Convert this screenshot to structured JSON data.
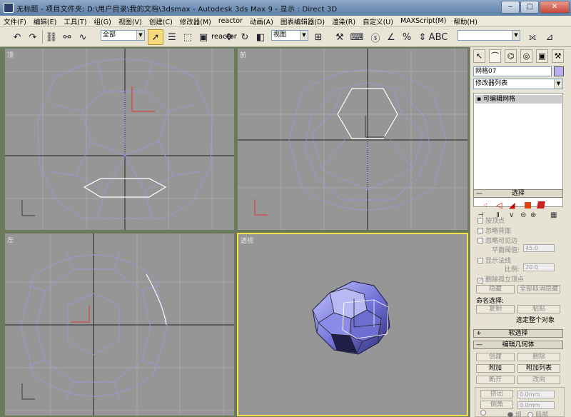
{
  "titlebar": {
    "title": "无标题  - 项目文件夹: D:\\用户目录\\我的文档\\3dsmax   - Autodesk 3ds Max 9   - 显示 : Direct 3D",
    "minimize": "‒",
    "maximize": "□",
    "close": "✕"
  },
  "menu": [
    "文件(F)",
    "编辑(E)",
    "工具(T)",
    "组(G)",
    "视图(V)",
    "创建(C)",
    "修改器(M)",
    "reactor",
    "动画(A)",
    "图表编辑器(D)",
    "渲染(R)",
    "自定义(U)",
    "MAXScript(M)",
    "帮助(H)"
  ],
  "toolbar": {
    "selection_filter": "全部",
    "reference_coord": "视图",
    "named_selection": ""
  },
  "viewports": {
    "top": "顶",
    "front": "前",
    "left": "左",
    "perspective": "透视"
  },
  "panel": {
    "object_name": "网格07",
    "object_color": "#b8aef0",
    "modifier_list": "修改器列表",
    "stack_item": "可编辑网格",
    "selection": {
      "title": "选择",
      "by_vertex": "按顶点",
      "ignore_backfacing": "忽略背面",
      "ignore_visible_edges": "忽略可见边",
      "planar_threshold_label": "平面阈值:",
      "planar_threshold_value": "45.0",
      "show_normals": "显示法线",
      "scale_label": "比例:",
      "scale_value": "20.0",
      "delete_isolated_vertices": "删除孤立顶点",
      "hide": "隐藏",
      "unhide_all": "全部取消隐藏",
      "named_selections": "命名选择:",
      "copy": "复制",
      "paste": "粘贴",
      "status": "选定整个对象"
    },
    "soft_selection": {
      "title": "软选择"
    },
    "edit_geometry": {
      "title": "编辑几何体",
      "create": "创建",
      "delete": "删除",
      "attach": "附加",
      "attach_list": "附加列表",
      "detach": "断开",
      "turn": "改向",
      "extrude": "挤出",
      "extrude_value": "0.0mm",
      "chamfer": "倒角",
      "chamfer_value": "0.0mm",
      "normal_group": "组",
      "normal_local": "局部"
    }
  }
}
